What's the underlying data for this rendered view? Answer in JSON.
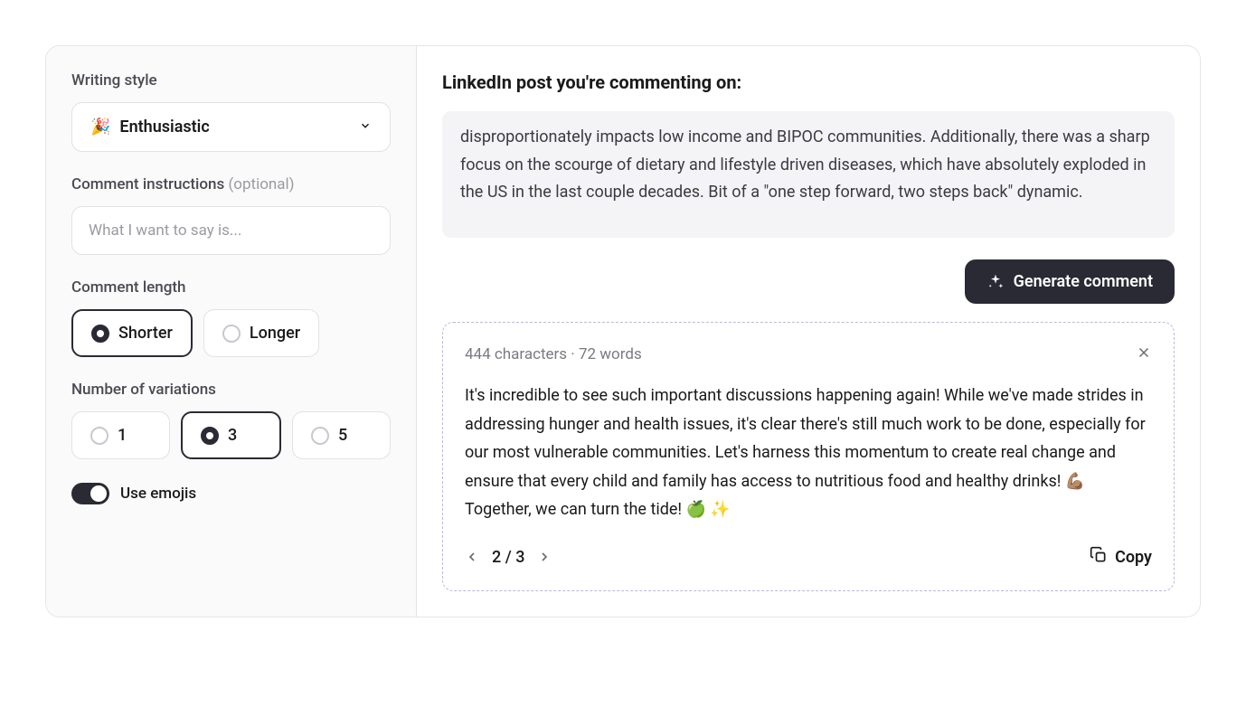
{
  "sidebar": {
    "writing_style": {
      "label": "Writing style",
      "emoji": "🎉",
      "value": "Enthusiastic"
    },
    "comment_instructions": {
      "label": "Comment instructions",
      "optional": "(optional)",
      "placeholder": "What I want to say is..."
    },
    "comment_length": {
      "label": "Comment length",
      "options": {
        "shorter": "Shorter",
        "longer": "Longer"
      },
      "selected": "shorter"
    },
    "variations": {
      "label": "Number of variations",
      "options": {
        "one": "1",
        "three": "3",
        "five": "5"
      },
      "selected": "three"
    },
    "emojis_toggle": {
      "label": "Use emojis",
      "enabled": true
    }
  },
  "main": {
    "post_header": "LinkedIn post you're commenting on:",
    "post_text": "disproportionately impacts low income and BIPOC communities. Additionally, there was a sharp focus on the scourge of dietary and lifestyle driven diseases, which have absolutely exploded in the US in the last couple decades. Bit of a \"one step forward, two steps back\" dynamic.",
    "generate_label": "Generate comment",
    "result": {
      "char_count": "444 characters",
      "word_count": "72 words",
      "separator": " · ",
      "text": "It's incredible to see such important discussions happening again! While we've made strides in addressing hunger and health issues, it's clear there's still much work to be done, especially for our most vulnerable communities. Let's harness this momentum to create real change and ensure that every child and family has access to nutritious food and healthy drinks! 💪🏽 Together, we can turn the tide! 🍏 ✨",
      "page_current": "2",
      "page_total": "3",
      "page_sep": " / ",
      "copy_label": "Copy"
    }
  }
}
